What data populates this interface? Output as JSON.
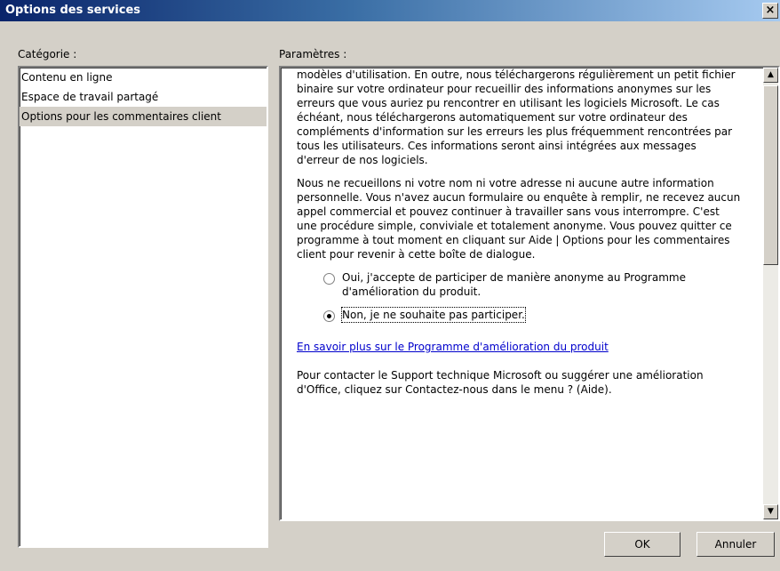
{
  "window": {
    "title": "Options des services",
    "close_glyph": "×"
  },
  "category": {
    "label": "Catégorie :",
    "items": [
      {
        "label": "Contenu en ligne"
      },
      {
        "label": "Espace de travail partagé"
      },
      {
        "label": "Options pour les commentaires client",
        "selected": true
      }
    ]
  },
  "params": {
    "label": "Paramètres :",
    "paragraph1": "modèles d'utilisation. En outre, nous téléchargerons régulièrement un petit fichier binaire sur votre ordinateur pour recueillir des informations anonymes sur les erreurs que vous auriez pu rencontrer en utilisant les logiciels Microsoft. Le cas échéant, nous téléchargerons automatiquement sur votre ordinateur des compléments d'information sur les erreurs les plus fréquemment rencontrées par tous les utilisateurs. Ces informations seront ainsi intégrées aux messages d'erreur de nos logiciels.",
    "paragraph2": "Nous ne recueillons ni votre nom ni votre adresse ni aucune autre information personnelle. Vous n'avez aucun formulaire ou enquête à remplir, ne recevez aucun appel commercial et pouvez continuer à travailler sans vous interrompre. C'est une procédure simple, conviviale et totalement anonyme. Vous pouvez quitter ce programme à tout moment en cliquant sur Aide | Options pour les commentaires client pour revenir à cette boîte de dialogue.",
    "radio_yes": "Oui, j'accepte de participer de manière anonyme au Programme d'amélioration du produit.",
    "radio_no": "Non, je ne souhaite pas participer.",
    "selected_option": "no",
    "link": "En savoir plus sur le Programme d'amélioration du produit",
    "paragraph3": "Pour contacter le Support technique Microsoft ou suggérer une amélioration d'Office, cliquez sur Contactez-nous dans le menu ? (Aide)."
  },
  "buttons": {
    "ok": "OK",
    "cancel": "Annuler"
  },
  "icons": {
    "scroll_up": "▲",
    "scroll_down": "▼"
  }
}
